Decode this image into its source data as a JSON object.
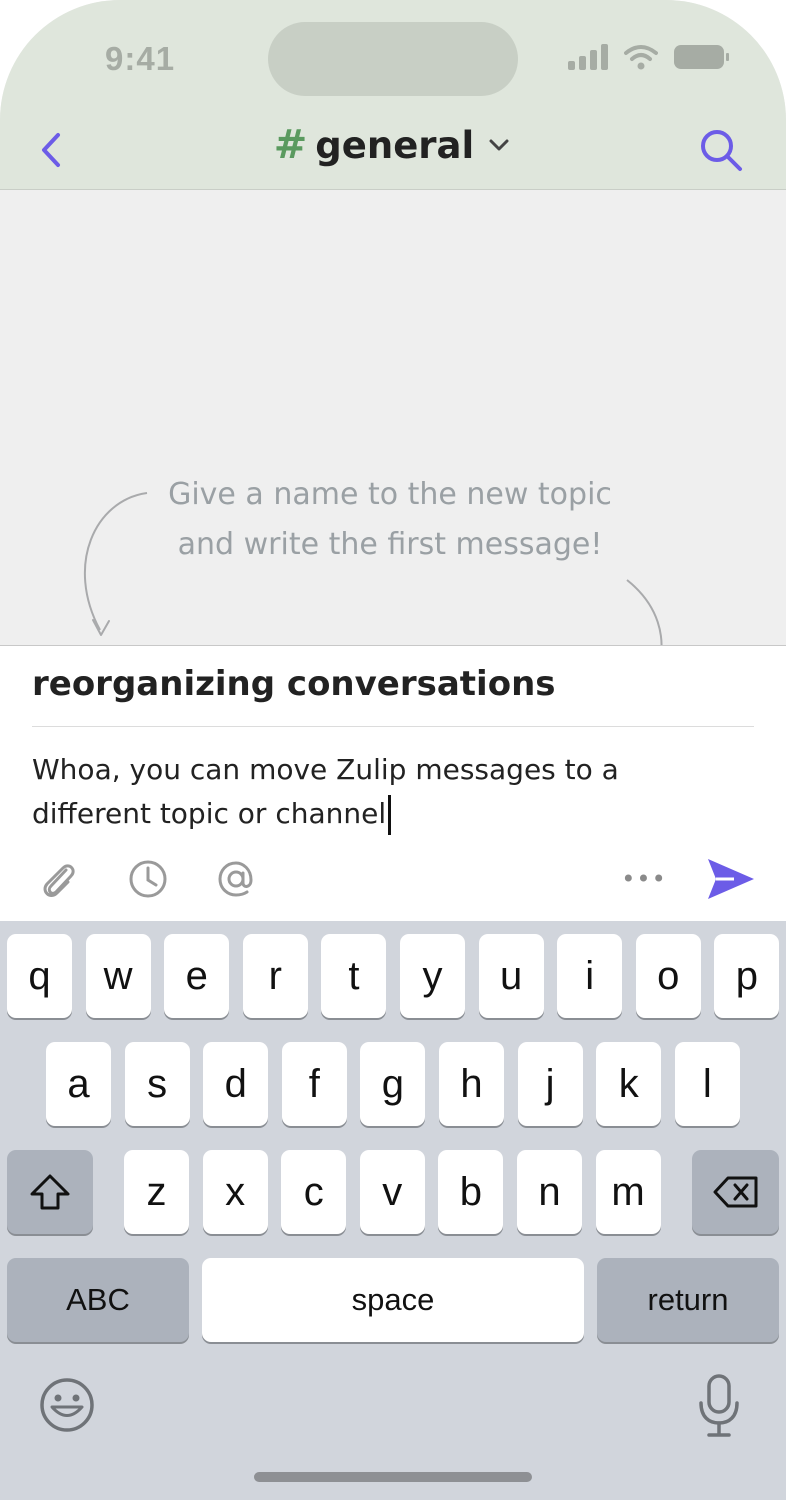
{
  "status_bar": {
    "time": "9:41"
  },
  "header": {
    "channel_name": "general",
    "channel_prefix": "#"
  },
  "hint": {
    "line1": "Give a name to the new topic",
    "line2": "and write the first message!"
  },
  "compose": {
    "topic": "reorganizing conversations",
    "message_line1": "Whoa, you can move Zulip messages to a",
    "message_line2": "different topic or channel"
  },
  "toolbar": {
    "more_label": "•••"
  },
  "keyboard": {
    "row1": [
      "q",
      "w",
      "e",
      "r",
      "t",
      "y",
      "u",
      "i",
      "o",
      "p"
    ],
    "row2": [
      "a",
      "s",
      "d",
      "f",
      "g",
      "h",
      "j",
      "k",
      "l"
    ],
    "row3": [
      "z",
      "x",
      "c",
      "v",
      "b",
      "n",
      "m"
    ],
    "abc_label": "ABC",
    "space_label": "space",
    "return_label": "return"
  },
  "colors": {
    "accent": "#6c5ce7",
    "channel_green": "#5a9a5f",
    "header_bg": "#dfe6dc",
    "hint": "#9aa0a4"
  }
}
